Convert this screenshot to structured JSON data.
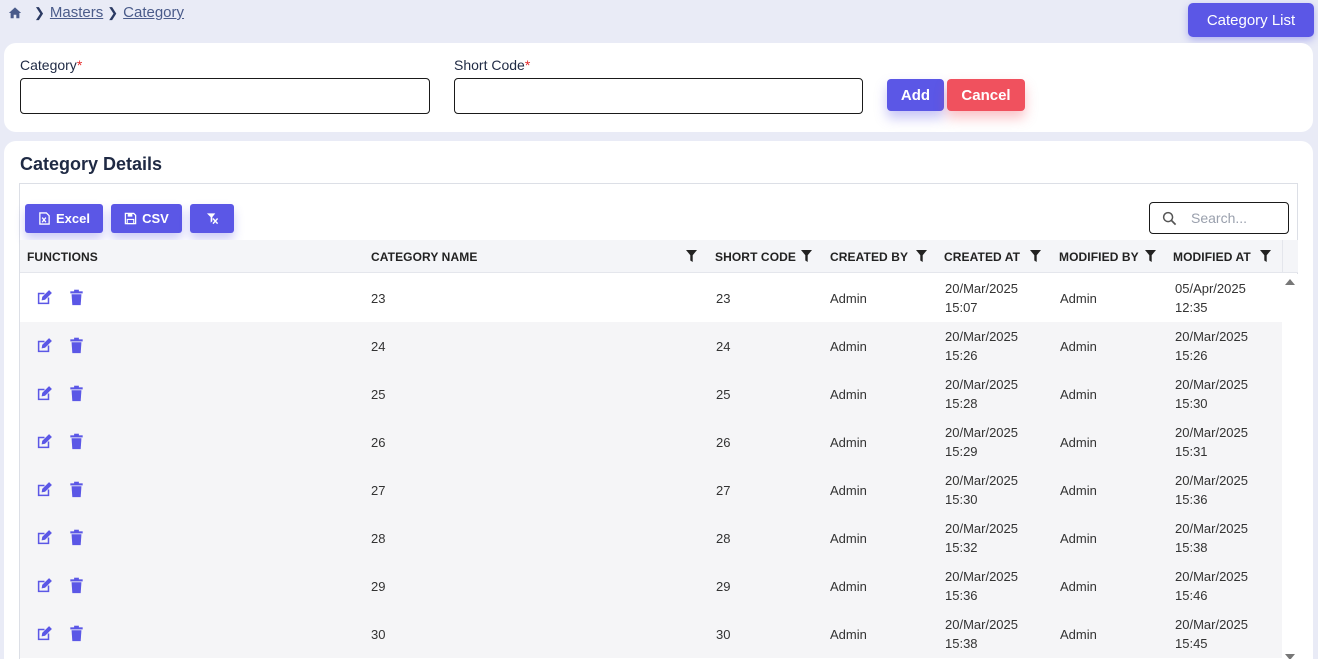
{
  "breadcrumb": {
    "items": [
      "Masters",
      "Category"
    ]
  },
  "header": {
    "list_button": "Category List"
  },
  "form": {
    "category_label": "Category",
    "short_code_label": "Short Code",
    "required_mark": "*",
    "category_value": "",
    "short_code_value": "",
    "add_label": "Add",
    "cancel_label": "Cancel"
  },
  "details": {
    "title": "Category Details",
    "excel_label": "Excel",
    "csv_label": "CSV",
    "search_placeholder": "Search..."
  },
  "table": {
    "columns": {
      "functions": "FUNCTIONS",
      "category_name": "CATEGORY NAME",
      "short_code": "SHORT CODE",
      "created_by": "CREATED BY",
      "created_at": "CREATED AT",
      "modified_by": "MODIFIED BY",
      "modified_at": "MODIFIED AT"
    },
    "rows": [
      {
        "name": "23",
        "code": "23",
        "created_by": "Admin",
        "created_date": "20/Mar/2025",
        "created_time": "15:07",
        "modified_by": "Admin",
        "modified_date": "05/Apr/2025",
        "modified_time": "12:35"
      },
      {
        "name": "24",
        "code": "24",
        "created_by": "Admin",
        "created_date": "20/Mar/2025",
        "created_time": "15:26",
        "modified_by": "Admin",
        "modified_date": "20/Mar/2025",
        "modified_time": "15:26"
      },
      {
        "name": "25",
        "code": "25",
        "created_by": "Admin",
        "created_date": "20/Mar/2025",
        "created_time": "15:28",
        "modified_by": "Admin",
        "modified_date": "20/Mar/2025",
        "modified_time": "15:30"
      },
      {
        "name": "26",
        "code": "26",
        "created_by": "Admin",
        "created_date": "20/Mar/2025",
        "created_time": "15:29",
        "modified_by": "Admin",
        "modified_date": "20/Mar/2025",
        "modified_time": "15:31"
      },
      {
        "name": "27",
        "code": "27",
        "created_by": "Admin",
        "created_date": "20/Mar/2025",
        "created_time": "15:30",
        "modified_by": "Admin",
        "modified_date": "20/Mar/2025",
        "modified_time": "15:36"
      },
      {
        "name": "28",
        "code": "28",
        "created_by": "Admin",
        "created_date": "20/Mar/2025",
        "created_time": "15:32",
        "modified_by": "Admin",
        "modified_date": "20/Mar/2025",
        "modified_time": "15:38"
      },
      {
        "name": "29",
        "code": "29",
        "created_by": "Admin",
        "created_date": "20/Mar/2025",
        "created_time": "15:36",
        "modified_by": "Admin",
        "modified_date": "20/Mar/2025",
        "modified_time": "15:46"
      },
      {
        "name": "30",
        "code": "30",
        "created_by": "Admin",
        "created_date": "20/Mar/2025",
        "created_time": "15:38",
        "modified_by": "Admin",
        "modified_date": "20/Mar/2025",
        "modified_time": "15:45"
      }
    ]
  },
  "icons": {
    "home": "home-icon",
    "edit": "edit-icon",
    "delete": "trash-icon",
    "filter": "filter-icon",
    "excel": "excel-file-icon",
    "csv": "save-file-icon",
    "clear_filter": "clear-filter-icon",
    "search": "search-icon"
  },
  "colors": {
    "primary": "#5b57e6",
    "danger": "#f0515e",
    "background": "#e9ebf6",
    "required": "#e52a2a"
  }
}
